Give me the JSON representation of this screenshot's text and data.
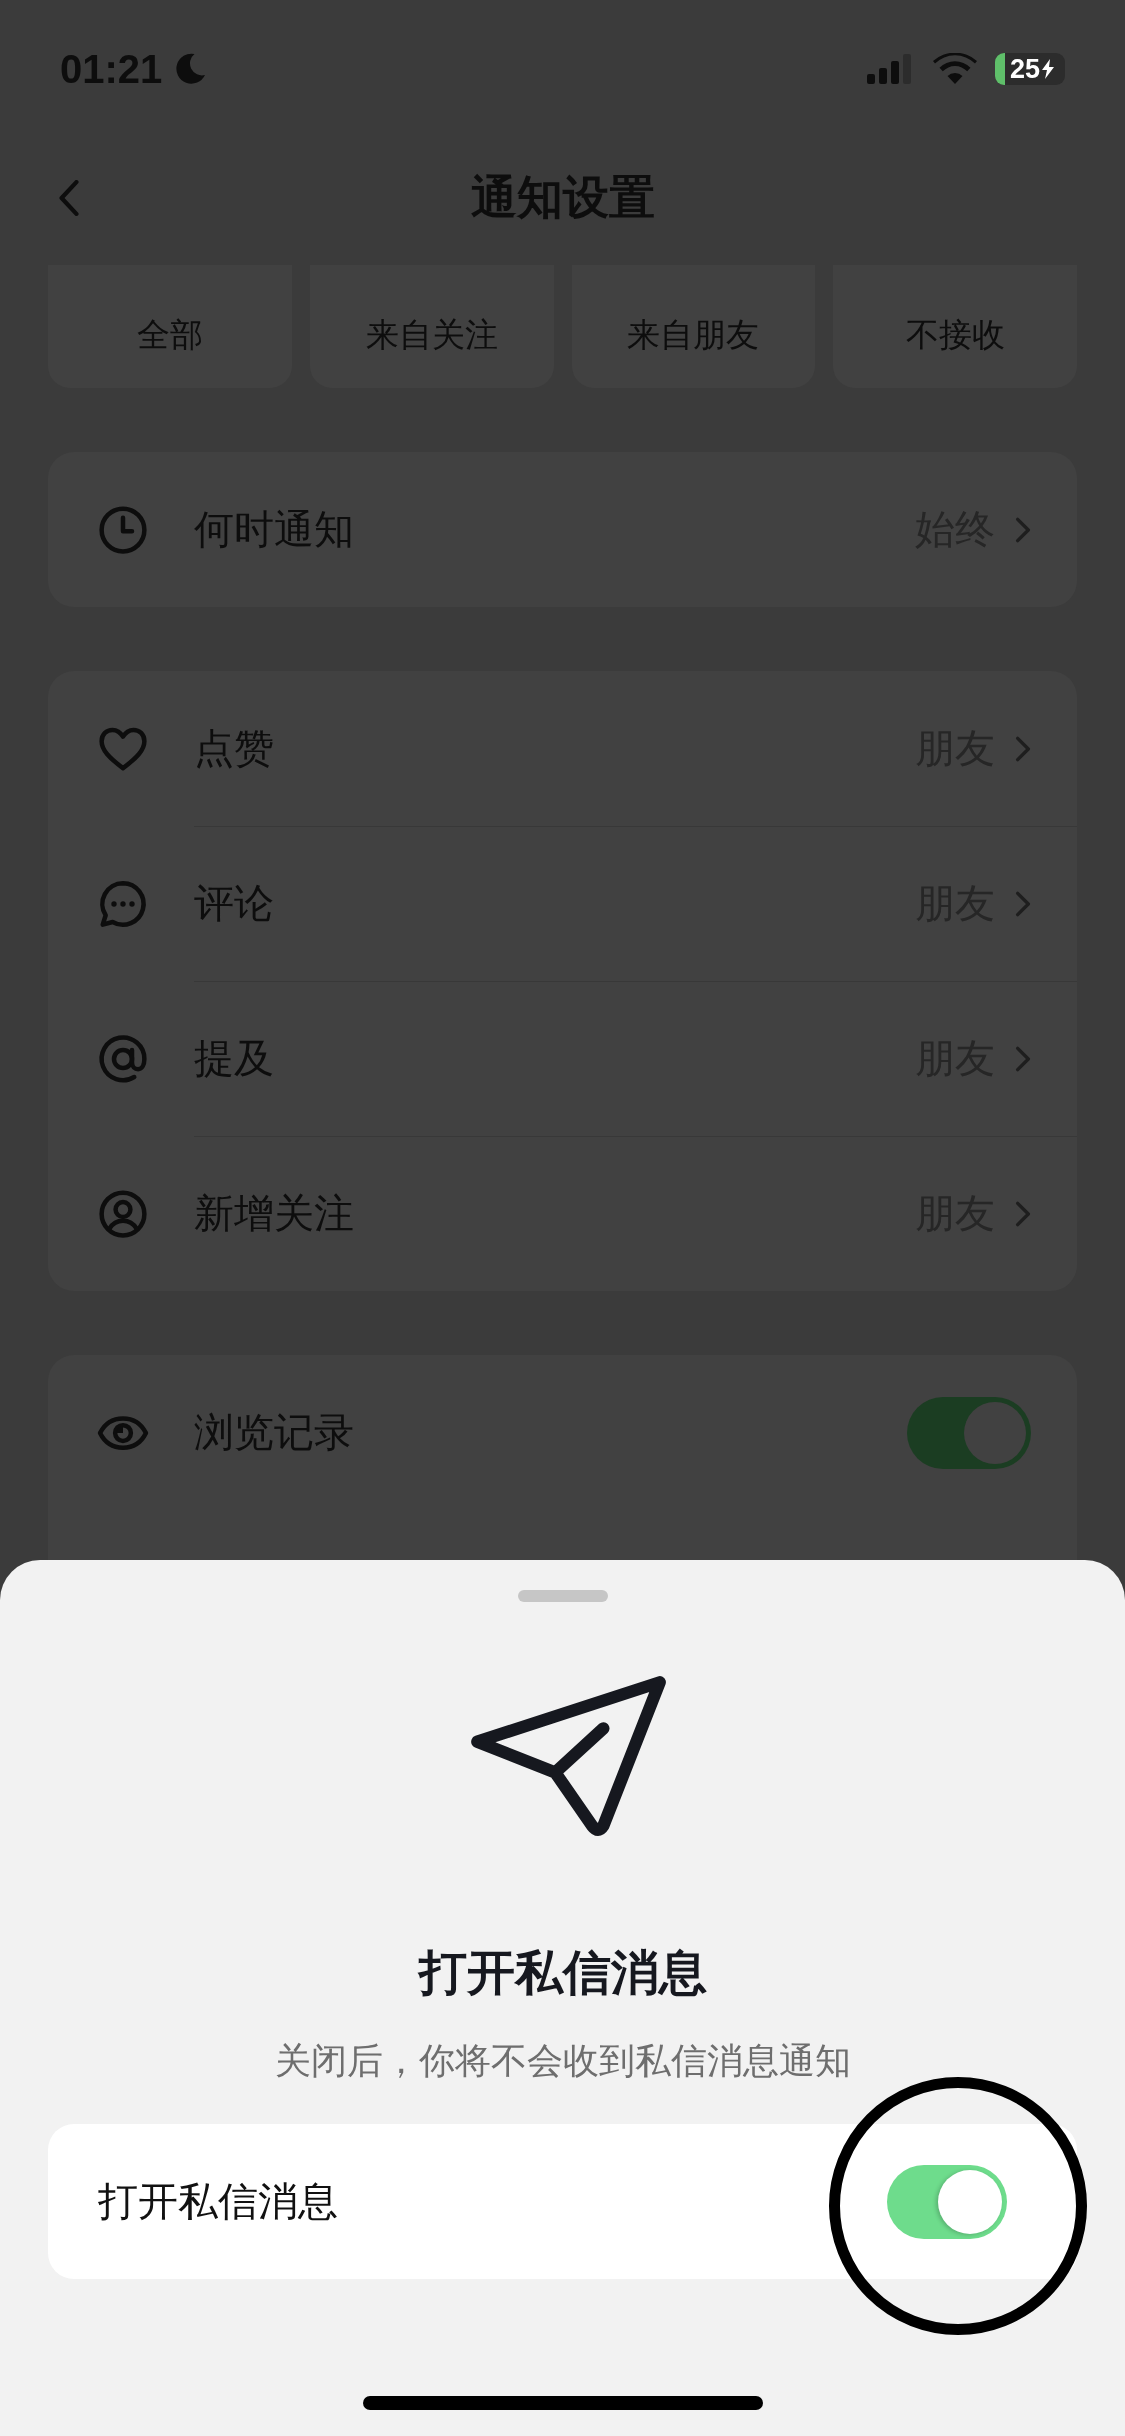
{
  "status_bar": {
    "time": "01:21",
    "battery": "25"
  },
  "nav": {
    "title": "通知设置"
  },
  "filters": [
    {
      "label": "全部"
    },
    {
      "label": "来自关注"
    },
    {
      "label": "来自朋友"
    },
    {
      "label": "不接收"
    }
  ],
  "when": {
    "kind": "clock",
    "label": "何时通知",
    "value": "始终"
  },
  "interactions": [
    {
      "kind": "heart",
      "label": "点赞",
      "value": "朋友"
    },
    {
      "kind": "comment",
      "label": "评论",
      "value": "朋友"
    },
    {
      "kind": "at",
      "label": "提及",
      "value": "朋友"
    },
    {
      "kind": "person",
      "label": "新增关注",
      "value": "朋友"
    }
  ],
  "toggles": [
    {
      "kind": "eye",
      "label": "浏览记录",
      "on": true
    }
  ],
  "sheet": {
    "title": "打开私信消息",
    "subtitle": "关闭后，你将不会收到私信消息通知",
    "option": {
      "label": "打开私信消息",
      "on": true,
      "circled": true
    }
  }
}
